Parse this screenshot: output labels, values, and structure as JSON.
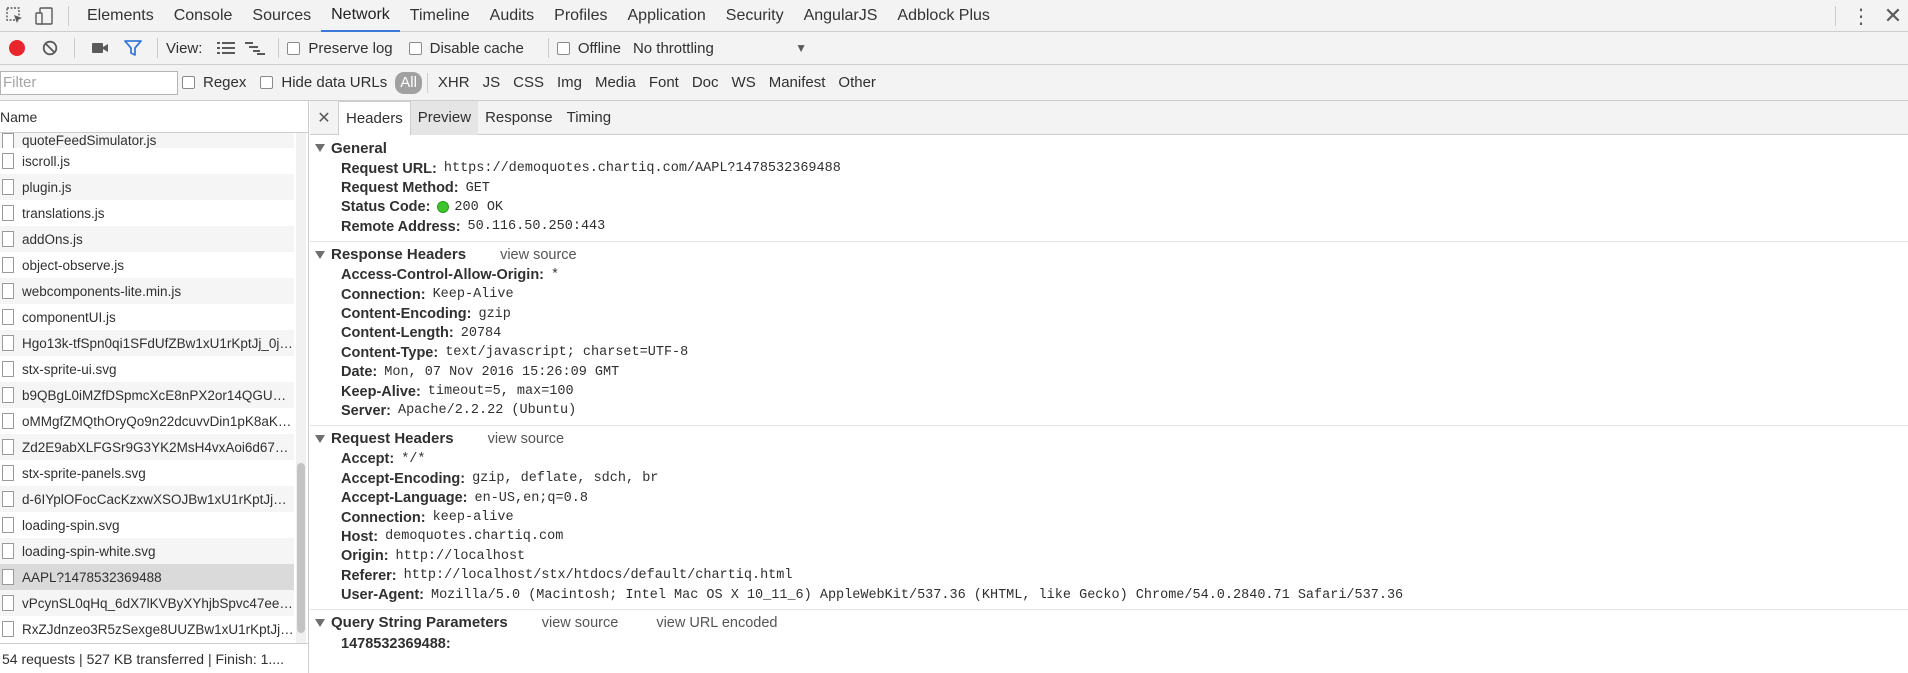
{
  "main_tabs": [
    "Elements",
    "Console",
    "Sources",
    "Network",
    "Timeline",
    "Audits",
    "Profiles",
    "Application",
    "Security",
    "AngularJS",
    "Adblock Plus"
  ],
  "active_tab": "Network",
  "toolbar": {
    "view_label": "View:",
    "preserve_log": "Preserve log",
    "disable_cache": "Disable cache",
    "offline": "Offline",
    "throttling": "No throttling"
  },
  "filter": {
    "placeholder": "Filter",
    "regex": "Regex",
    "hide_data_urls": "Hide data URLs",
    "types": [
      "All",
      "XHR",
      "JS",
      "CSS",
      "Img",
      "Media",
      "Font",
      "Doc",
      "WS",
      "Manifest",
      "Other"
    ]
  },
  "request_list": {
    "header": "Name",
    "items": [
      "quoteFeedSimulator.js",
      "iscroll.js",
      "plugin.js",
      "translations.js",
      "addOns.js",
      "object-observe.js",
      "webcomponents-lite.min.js",
      "componentUI.js",
      "Hgo13k-tfSpn0qi1SFdUfZBw1xU1rKptJj_0jan...",
      "stx-sprite-ui.svg",
      "b9QBgL0iMZfDSpmcXcE8nPX2or14QGUHg...",
      "oMMgfZMQthOryQo9n22dcuvvDin1pK8aKte...",
      "Zd2E9abXLFGSr9G3YK2MsH4vxAoi6d67T_...",
      "stx-sprite-panels.svg",
      "d-6IYplOFocCacKzxwXSOJBw1xU1rKptJj_0ja...",
      "loading-spin.svg",
      "loading-spin-white.svg",
      "AAPL?1478532369488",
      "vPcynSL0qHq_6dX7lKVByXYhjbSpvc47ee6x...",
      "RxZJdnzeo3R5zSexge8UUZBw1xU1rKptJj_0j..."
    ],
    "selected": "AAPL?1478532369488",
    "status": "54 requests  |  527 KB transferred  |  Finish: 1...."
  },
  "detail_tabs": [
    "Headers",
    "Preview",
    "Response",
    "Timing"
  ],
  "active_detail_tab": "Headers",
  "general": {
    "title": "General",
    "rows": [
      {
        "k": "Request URL:",
        "v": "https://demoquotes.chartiq.com/AAPL?1478532369488"
      },
      {
        "k": "Request Method:",
        "v": "GET"
      },
      {
        "k": "Status Code:",
        "v": "200 OK"
      },
      {
        "k": "Remote Address:",
        "v": "50.116.50.250:443"
      }
    ]
  },
  "response_headers": {
    "title": "Response Headers",
    "view_source": "view source",
    "rows": [
      {
        "k": "Access-Control-Allow-Origin:",
        "v": "*"
      },
      {
        "k": "Connection:",
        "v": "Keep-Alive"
      },
      {
        "k": "Content-Encoding:",
        "v": "gzip"
      },
      {
        "k": "Content-Length:",
        "v": "20784"
      },
      {
        "k": "Content-Type:",
        "v": "text/javascript; charset=UTF-8"
      },
      {
        "k": "Date:",
        "v": "Mon, 07 Nov 2016 15:26:09 GMT"
      },
      {
        "k": "Keep-Alive:",
        "v": "timeout=5, max=100"
      },
      {
        "k": "Server:",
        "v": "Apache/2.2.22 (Ubuntu)"
      }
    ]
  },
  "request_headers": {
    "title": "Request Headers",
    "view_source": "view source",
    "rows": [
      {
        "k": "Accept:",
        "v": "*/*"
      },
      {
        "k": "Accept-Encoding:",
        "v": "gzip, deflate, sdch, br"
      },
      {
        "k": "Accept-Language:",
        "v": "en-US,en;q=0.8"
      },
      {
        "k": "Connection:",
        "v": "keep-alive"
      },
      {
        "k": "Host:",
        "v": "demoquotes.chartiq.com"
      },
      {
        "k": "Origin:",
        "v": "http://localhost"
      },
      {
        "k": "Referer:",
        "v": "http://localhost/stx/htdocs/default/chartiq.html"
      },
      {
        "k": "User-Agent:",
        "v": "Mozilla/5.0 (Macintosh; Intel Mac OS X 10_11_6) AppleWebKit/537.36 (KHTML, like Gecko) Chrome/54.0.2840.71 Safari/537.36"
      }
    ]
  },
  "query_params": {
    "title": "Query String Parameters",
    "view_source": "view source",
    "view_url_encoded": "view URL encoded",
    "rows": [
      {
        "k": "1478532369488:",
        "v": ""
      }
    ]
  },
  "colors": {
    "accent": "#3879d9",
    "record": "#e8262c",
    "status_ok": "#3cc52c"
  }
}
